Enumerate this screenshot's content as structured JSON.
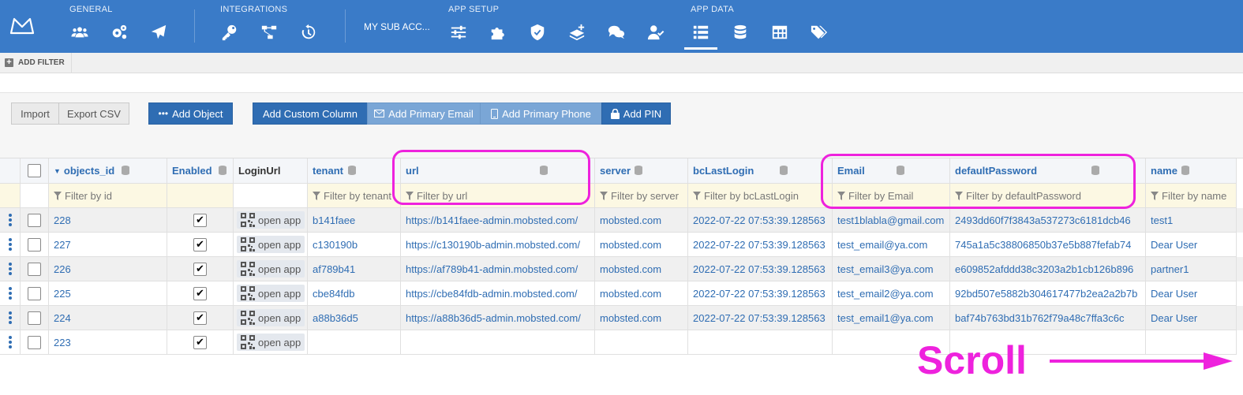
{
  "nav": {
    "groups": [
      {
        "label": "GENERAL"
      },
      {
        "label": "INTEGRATIONS"
      },
      {
        "label": "APP SETUP"
      },
      {
        "label": "APP DATA"
      }
    ],
    "sub_account": "MY SUB ACC...",
    "icons": [
      "users-icon",
      "cogs-icon",
      "send-icon",
      "key-icon",
      "flow-icon",
      "history-icon",
      "sliders-icon",
      "puzzle-icon",
      "shield-icon",
      "layers-icon",
      "chat-icon",
      "user-check-icon",
      "list-icon",
      "database-icon",
      "table-icon",
      "tags-icon"
    ]
  },
  "filterbar": {
    "add_filter": "ADD FILTER"
  },
  "toolbar": {
    "import": "Import",
    "export_csv": "Export CSV",
    "add_object": "Add Object",
    "add_custom_column": "Add Custom Column",
    "add_primary_email": "Add Primary Email",
    "add_primary_phone": "Add Primary Phone",
    "add_pin": "Add PIN"
  },
  "grid": {
    "headers": {
      "objects_id": "objects_id",
      "enabled": "Enabled",
      "login_url": "LoginUrl",
      "tenant": "tenant",
      "url": "url",
      "server": "server",
      "bc_last_login": "bcLastLogin",
      "email": "Email",
      "default_password": "defaultPassword",
      "name": "name"
    },
    "filters": {
      "objects_id": "Filter by id",
      "tenant": "Filter by tenant",
      "url": "Filter by url",
      "server": "Filter by server",
      "bc_last_login": "Filter by bcLastLogin",
      "email": "Filter by Email",
      "default_password": "Filter by defaultPassword",
      "name": "Filter by name"
    },
    "open_app_label": "open app",
    "rows": [
      {
        "id": "228",
        "enabled": true,
        "tenant": "b141faee",
        "url": "https://b141faee-admin.mobsted.com/",
        "server": "mobsted.com",
        "last_login": "2022-07-22 07:53:39.128563",
        "email": "test1blabla@gmail.com",
        "password": "2493dd60f7f3843a537273c6181dcb46",
        "name": "test1"
      },
      {
        "id": "227",
        "enabled": true,
        "tenant": "c130190b",
        "url": "https://c130190b-admin.mobsted.com/",
        "server": "mobsted.com",
        "last_login": "2022-07-22 07:53:39.128563",
        "email": "test_email@ya.com",
        "password": "745a1a5c38806850b37e5b887fefab74",
        "name": "Dear User"
      },
      {
        "id": "226",
        "enabled": true,
        "tenant": "af789b41",
        "url": "https://af789b41-admin.mobsted.com/",
        "server": "mobsted.com",
        "last_login": "2022-07-22 07:53:39.128563",
        "email": "test_email3@ya.com",
        "password": "e609852afddd38c3203a2b1cb126b896",
        "name": "partner1"
      },
      {
        "id": "225",
        "enabled": true,
        "tenant": "cbe84fdb",
        "url": "https://cbe84fdb-admin.mobsted.com/",
        "server": "mobsted.com",
        "last_login": "2022-07-22 07:53:39.128563",
        "email": "test_email2@ya.com",
        "password": "92bd507e5882b304617477b2ea2a2b7b",
        "name": "Dear User"
      },
      {
        "id": "224",
        "enabled": true,
        "tenant": "a88b36d5",
        "url": "https://a88b36d5-admin.mobsted.com/",
        "server": "mobsted.com",
        "last_login": "2022-07-22 07:53:39.128563",
        "email": "test_email1@ya.com",
        "password": "baf74b763bd31b762f79a48c7ffa3c6c",
        "name": "Dear User"
      },
      {
        "id": "223",
        "enabled": true,
        "tenant": "",
        "url": "",
        "server": "",
        "last_login": "",
        "email": "",
        "password": "",
        "name": ""
      }
    ]
  },
  "annotation": {
    "scroll_text": "Scroll",
    "highlight_color": "#ee22dd"
  },
  "colors": {
    "nav_bg": "#3a7bc8",
    "primary": "#2f6db3",
    "filter_bg": "#fcf8e3"
  }
}
